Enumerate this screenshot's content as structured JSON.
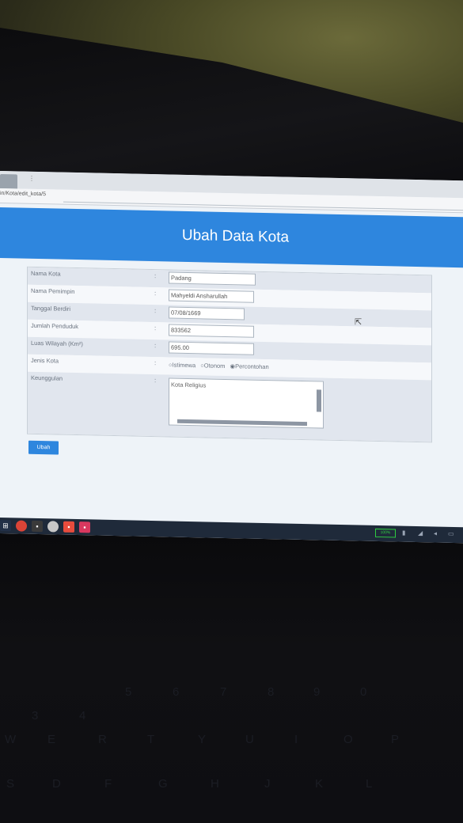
{
  "browser": {
    "url": "in/Kota/edit_kota/5"
  },
  "header": {
    "title": "Ubah Data Kota"
  },
  "form": {
    "separator": ":",
    "nama_kota": {
      "label": "Nama Kota",
      "value": "Padang"
    },
    "nama_pemimpin": {
      "label": "Nama Pemimpin",
      "value": "Mahyeldi Ansharullah"
    },
    "tanggal_berdiri": {
      "label": "Tanggal Berdiri",
      "value": "07/08/1669"
    },
    "jumlah_penduduk": {
      "label": "Jumlah Penduduk",
      "value": "833562"
    },
    "luas_wilayah": {
      "label": "Luas Wilayah (Km²)",
      "value": "695.00"
    },
    "jenis_kota": {
      "label": "Jenis Kota",
      "options": [
        "Istimewa",
        "Otonom",
        "Percontohan"
      ],
      "selected": "Percontohan"
    },
    "keunggulan": {
      "label": "Keunggulan",
      "value": "Kota Religius"
    },
    "submit_label": "Ubah"
  },
  "taskbar": {
    "battery": "100%"
  },
  "keyboard": {
    "row1": [
      "3",
      "4",
      "5",
      "6",
      "7",
      "8",
      "9",
      "0"
    ],
    "row2": [
      "W",
      "E",
      "R",
      "T",
      "Y",
      "U",
      "I",
      "O",
      "P"
    ],
    "row3": [
      "S",
      "D",
      "F",
      "G",
      "H",
      "J",
      "K",
      "L"
    ]
  }
}
